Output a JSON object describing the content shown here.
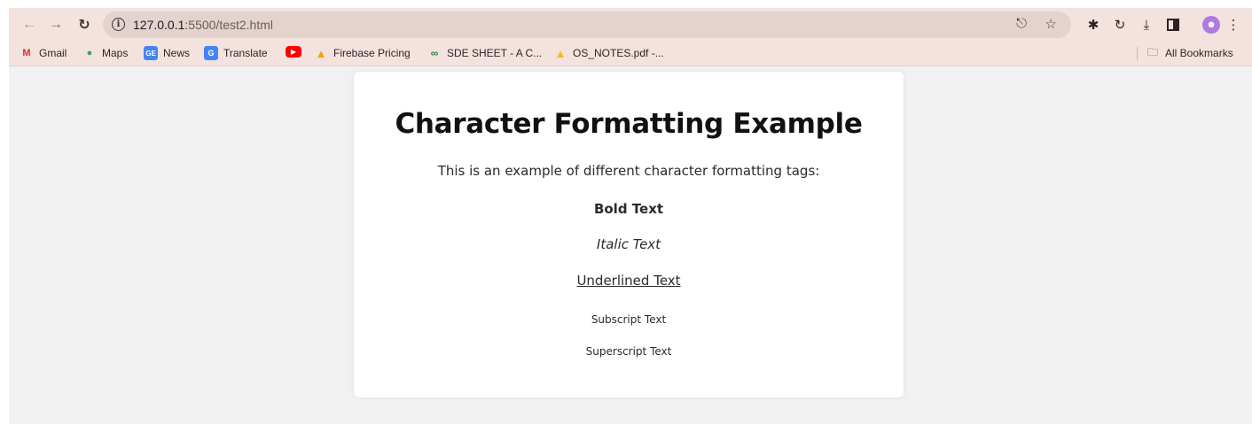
{
  "browser": {
    "url_host": "127.0.0.1",
    "url_rest": ":5500/test2.html",
    "bookmarks": [
      {
        "label": "Gmail",
        "icon": "gmail-icon"
      },
      {
        "label": "Maps",
        "icon": "maps-icon"
      },
      {
        "label": "News",
        "icon": "news-icon"
      },
      {
        "label": "Translate",
        "icon": "translate-icon"
      },
      {
        "label": "",
        "icon": "youtube-icon"
      },
      {
        "label": "Firebase Pricing",
        "icon": "firebase-icon"
      },
      {
        "label": "SDE SHEET - A C...",
        "icon": "link-icon"
      },
      {
        "label": "OS_NOTES.pdf -...",
        "icon": "drive-icon"
      }
    ],
    "all_bookmarks": "All Bookmarks",
    "colors": {
      "toolbar": "#f3e2dd",
      "omnibox": "#e3d2cd",
      "page_bg": "#f1f1f1",
      "card_bg": "#ffffff",
      "avatar": "#b07be0"
    }
  },
  "page": {
    "title": "Character Formatting Example",
    "intro": "This is an example of different character formatting tags:",
    "bold": "Bold Text",
    "italic": "Italic Text",
    "underline": "Underlined Text",
    "subscript": "Subscript Text",
    "superscript": "Superscript Text"
  }
}
